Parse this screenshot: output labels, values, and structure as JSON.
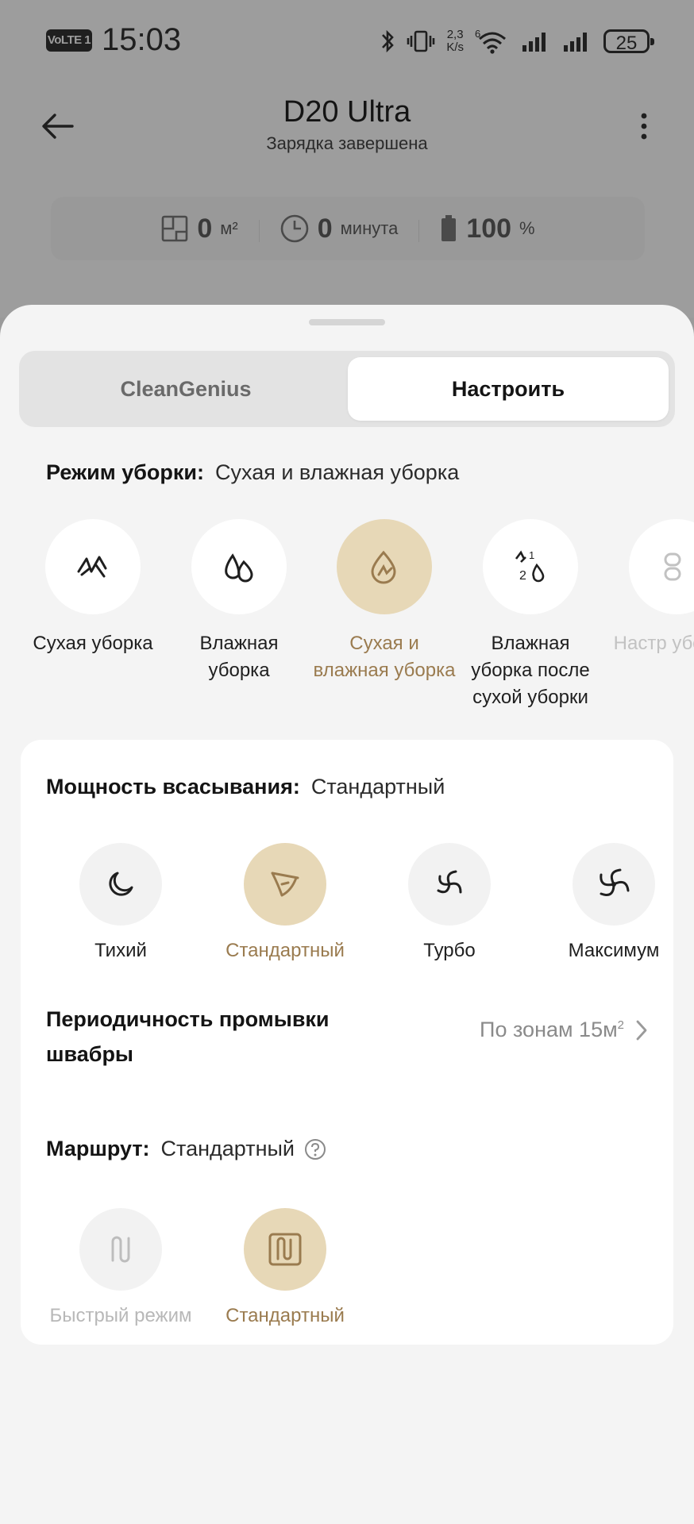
{
  "status_bar": {
    "volte": "VoLTE 1",
    "time": "15:03",
    "speed_value": "2,3",
    "speed_unit": "K/s",
    "wifi_label": "6",
    "battery": "25"
  },
  "header": {
    "title": "D20 Ultra",
    "subtitle": "Зарядка завершена"
  },
  "stats": [
    {
      "value": "0",
      "unit": "м²",
      "icon": "area-icon"
    },
    {
      "value": "0",
      "unit": "минута",
      "icon": "clock-icon"
    },
    {
      "value": "100",
      "unit": "%",
      "icon": "battery-icon"
    }
  ],
  "tabs": {
    "left": "CleanGenius",
    "right": "Настроить",
    "active": "right"
  },
  "cleaning_mode": {
    "label": "Режим уборки:",
    "value": "Сухая и влажная уборка",
    "options": [
      {
        "label": "Сухая уборка",
        "icon": "vacuum-icon",
        "active": false
      },
      {
        "label": "Влажная уборка",
        "icon": "drops-icon",
        "active": false
      },
      {
        "label": "Сухая и влажная уборка",
        "icon": "vacuum-mop-icon",
        "active": true
      },
      {
        "label": "Влажная уборка после сухой уборки",
        "icon": "sequence-icon",
        "active": false
      },
      {
        "label": "Настр убс ком",
        "icon": "custom-icon",
        "active": false
      }
    ]
  },
  "suction": {
    "label": "Мощность всасывания:",
    "value": "Стандартный",
    "options": [
      {
        "label": "Тихий",
        "icon": "quiet-icon",
        "active": false
      },
      {
        "label": "Стандартный",
        "icon": "standard-fan-icon",
        "active": true
      },
      {
        "label": "Турбо",
        "icon": "turbo-fan-icon",
        "active": false
      },
      {
        "label": "Максимум",
        "icon": "max-fan-icon",
        "active": false
      }
    ]
  },
  "mop_wash": {
    "label": "Периодичность промывки швабры",
    "value": "По зонам 15м",
    "value_sup": "2"
  },
  "route": {
    "label": "Маршрут:",
    "value": "Стандартный",
    "options": [
      {
        "label": "Быстрый режим",
        "icon": "quick-route-icon",
        "active": false
      },
      {
        "label": "Стандартный",
        "icon": "standard-route-icon",
        "active": true
      }
    ]
  },
  "colors": {
    "accent": "#9a7b4f",
    "accent_bg": "#e7d8b7",
    "sheet_bg": "#f4f4f4",
    "overlay_bg": "#9d9d9d"
  }
}
